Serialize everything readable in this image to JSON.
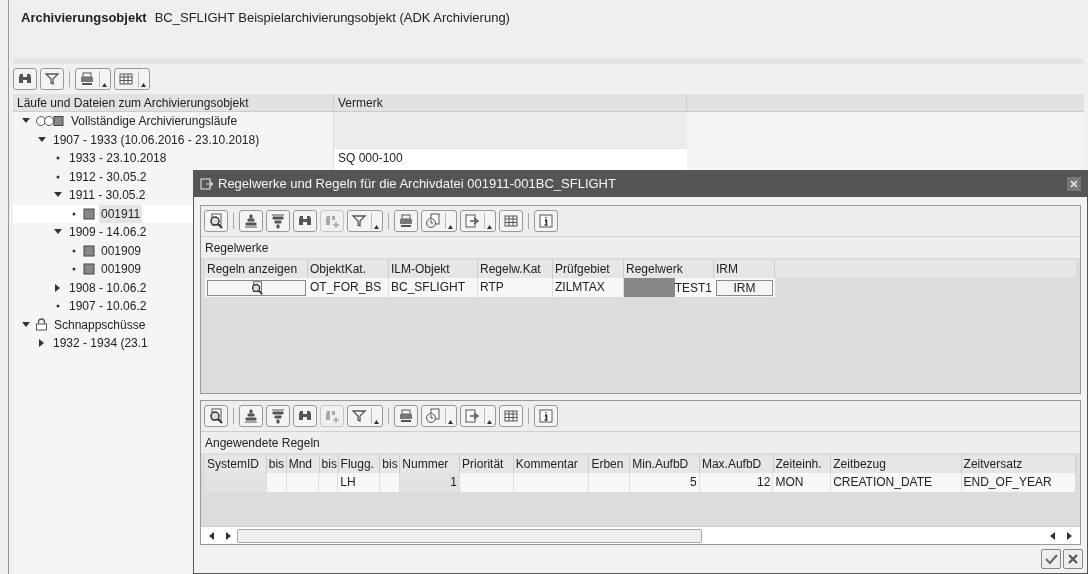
{
  "header": {
    "label": "Archivierungsobjekt",
    "value": "BC_SFLIGHT Beispielarchivierungsobjekt (ADK Archivierung)"
  },
  "tree": {
    "columns": [
      "Läufe und Dateien zum Archivierungsobjekt",
      "Vermerk"
    ],
    "items": [
      {
        "kind": "group",
        "label": "Vollständige Archivierungsläufe",
        "expanded": true,
        "selected": false,
        "children": [
          {
            "label": "1907 - 1933 (10.06.2016 - 23.10.2018)",
            "expanded": true,
            "selected": false,
            "children": [
              {
                "label": "1933 - 23.10.2018",
                "note": "SQ 000-100",
                "selected": false
              },
              {
                "label": "1912 - 30.05.2",
                "selected": false
              },
              {
                "label": "1911 - 30.05.2",
                "expanded": true,
                "selected": false,
                "children": [
                  {
                    "kind": "file",
                    "label": "001911",
                    "selected": true
                  }
                ]
              },
              {
                "label": "1909 - 14.06.2",
                "expanded": true,
                "selected": false,
                "children": [
                  {
                    "kind": "file",
                    "label": "001909",
                    "selected": false
                  },
                  {
                    "kind": "file",
                    "label": "001909",
                    "selected": false
                  }
                ]
              },
              {
                "label": "1908 - 10.06.2",
                "expanded": false,
                "selected": false
              },
              {
                "label": "1907 - 10.06.2",
                "selected": false
              }
            ]
          }
        ]
      },
      {
        "kind": "snapshot",
        "label": "Schnappschüsse",
        "expanded": true,
        "selected": false,
        "children": [
          {
            "label": "1932 - 1934 (23.1",
            "expanded": false,
            "selected": false
          }
        ]
      }
    ]
  },
  "dialog": {
    "title": "Regelwerke und Regeln für die Archivdatei 001911-001BC_SFLIGHT",
    "toolbar": [
      {
        "disabled": false
      },
      {
        "disabled": false
      },
      {
        "disabled": false
      },
      {
        "disabled": false
      },
      {
        "disabled": true
      },
      {
        "disabled": false
      },
      {
        "disabled": false
      },
      {
        "disabled": false
      },
      {
        "disabled": false
      },
      {
        "disabled": false
      },
      {
        "disabled": false
      }
    ],
    "rule_sets": {
      "title": "Regelwerke",
      "columns": [
        {
          "label": "Regeln anzeigen",
          "key": false
        },
        {
          "label": "ObjektKat.",
          "key": false
        },
        {
          "label": "ILM-Objekt",
          "key": false
        },
        {
          "label": "Regelw.Kat",
          "key": false
        },
        {
          "label": "Prüfgebiet",
          "key": false
        },
        {
          "label": "Regelwerk",
          "key": false
        },
        {
          "label": "IRM",
          "key": false
        }
      ],
      "rows": [
        [
          {
            "kind": "icon-button"
          },
          {
            "kind": "text",
            "text": "OT_FOR_BS"
          },
          {
            "kind": "text",
            "text": "BC_SFLIGHT"
          },
          {
            "kind": "text",
            "text": "RTP"
          },
          {
            "kind": "text",
            "text": "ZILMTAX"
          },
          {
            "kind": "masked",
            "text": "TEST1"
          },
          {
            "kind": "button",
            "text": "IRM"
          }
        ]
      ]
    },
    "rules": {
      "title": "Angewendete Regeln",
      "columns": [
        {
          "label": "SystemID",
          "key": true
        },
        {
          "label": "bis",
          "key": false
        },
        {
          "label": "Mnd",
          "key": false
        },
        {
          "label": "bis",
          "key": false
        },
        {
          "label": "Flugg.",
          "key": false
        },
        {
          "label": "bis",
          "key": false
        },
        {
          "label": "Nummer",
          "key": true
        },
        {
          "label": "Priorität",
          "key": false
        },
        {
          "label": "Kommentar",
          "key": false
        },
        {
          "label": "Erben",
          "key": false
        },
        {
          "label": "Min.AufbD",
          "key": false
        },
        {
          "label": "Max.AufbD",
          "key": false
        },
        {
          "label": "Zeiteinh.",
          "key": false
        },
        {
          "label": "Zeitbezug",
          "key": false
        },
        {
          "label": "Zeitversatz",
          "key": false
        }
      ],
      "rows": [
        [
          {
            "kind": "empty"
          },
          {
            "kind": "empty"
          },
          {
            "kind": "empty"
          },
          {
            "kind": "empty"
          },
          {
            "kind": "text",
            "text": "LH"
          },
          {
            "kind": "empty"
          },
          {
            "kind": "number",
            "text": "1"
          },
          {
            "kind": "empty"
          },
          {
            "kind": "empty"
          },
          {
            "kind": "empty"
          },
          {
            "kind": "number",
            "text": "5"
          },
          {
            "kind": "number",
            "text": "12"
          },
          {
            "kind": "text",
            "text": "MON"
          },
          {
            "kind": "text",
            "text": "CREATION_DATE"
          },
          {
            "kind": "text",
            "text": "END_OF_YEAR"
          }
        ]
      ]
    }
  }
}
